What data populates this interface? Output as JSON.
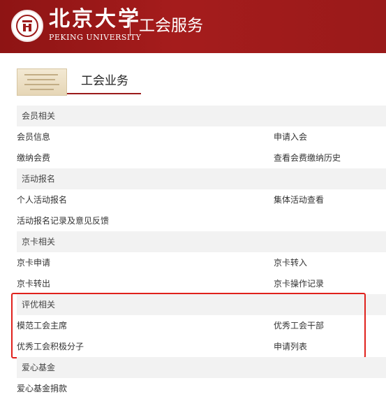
{
  "header": {
    "logo_cn": "北京大学",
    "logo_en": "PEKING UNIVERSITY",
    "site_title": "工会服务",
    "brand_color": "#a51c1c"
  },
  "section": {
    "title": "工会业务"
  },
  "groups": [
    {
      "category": "会员相关",
      "rows": [
        [
          "会员信息",
          "申请入会"
        ],
        [
          "缴纳会费",
          "查看会费缴纳历史"
        ]
      ]
    },
    {
      "category": "活动报名",
      "rows": [
        [
          "个人活动报名",
          "集体活动查看"
        ],
        [
          "活动报名记录及意见反馈",
          ""
        ]
      ]
    },
    {
      "category": "京卡相关",
      "rows": [
        [
          "京卡申请",
          "京卡转入"
        ],
        [
          "京卡转出",
          "京卡操作记录"
        ]
      ]
    },
    {
      "category": "评优相关",
      "highlighted": true,
      "highlight_color": "#e0211c",
      "rows": [
        [
          "模范工会主席",
          "优秀工会干部"
        ],
        [
          "优秀工会积极分子",
          "申请列表"
        ]
      ]
    },
    {
      "category": "爱心基金",
      "rows": [
        [
          "爱心基金捐款",
          ""
        ]
      ]
    }
  ]
}
